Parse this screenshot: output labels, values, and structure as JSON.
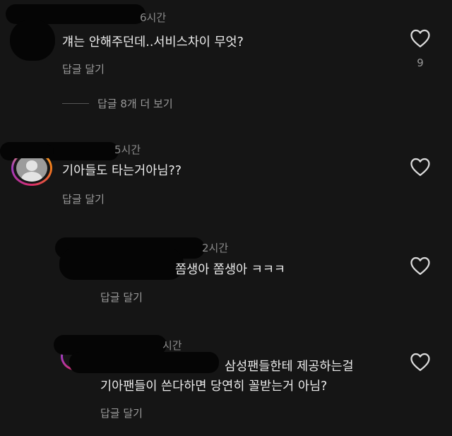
{
  "comments": [
    {
      "time": "6시간",
      "text": "걔는 안해주던데..서비스차이 무엇?",
      "reply_label": "답글 달기",
      "like_count": "9",
      "view_more_label": "답글 8개 더 보기"
    },
    {
      "time": "5시간",
      "text": "기아들도 타는거아님??",
      "reply_label": "답글 달기"
    },
    {
      "time": "2시간",
      "text": "쫌생아 쫌생아 ㅋㅋㅋ",
      "reply_label": "답글 달기"
    },
    {
      "time": "시간",
      "text_line1": "삼성팬들한테 제공하는걸",
      "text_line2": "기아팬들이 쓴다하면 당연히 꼴받는거 아님?",
      "reply_label": "답글 달기"
    }
  ],
  "icons": {
    "like": "heart-outline-icon",
    "avatar": "default-profile-avatar-icon"
  },
  "colors": {
    "background": "#151515",
    "text": "#ececec",
    "secondary": "#9a9a9a",
    "redaction": "#050505"
  }
}
